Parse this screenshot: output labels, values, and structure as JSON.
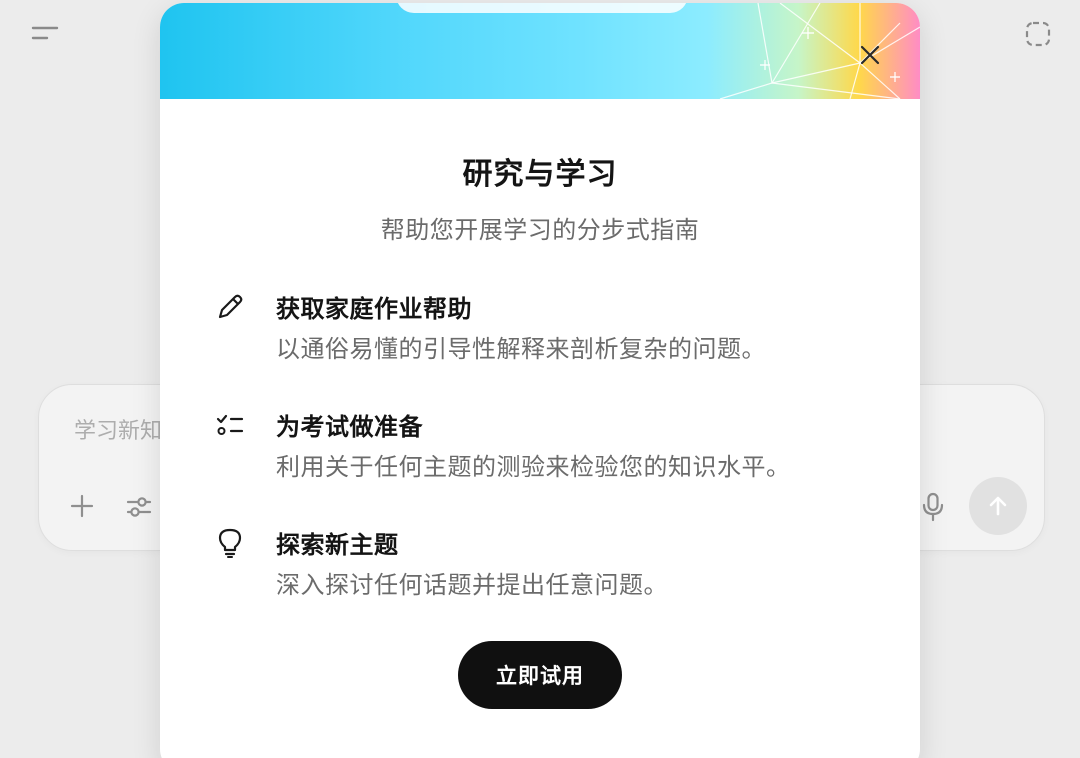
{
  "composer": {
    "placeholder": "学习新知识",
    "icons": [
      "plus-icon",
      "sliders-icon",
      "microphone-icon",
      "arrow-up-icon"
    ]
  },
  "header_icons": [
    "menu-icon",
    "dashed-square-icon"
  ],
  "dialog": {
    "title": "研究与学习",
    "subtitle": "帮助您开展学习的分步式指南",
    "close_icon": "close-icon",
    "features": [
      {
        "icon": "pencil-icon",
        "title": "获取家庭作业帮助",
        "description": "以通俗易懂的引导性解释来剖析复杂的问题。"
      },
      {
        "icon": "checklist-icon",
        "title": "为考试做准备",
        "description": "利用关于任何主题的测验来检验您的知识水平。"
      },
      {
        "icon": "lightbulb-icon",
        "title": "探索新主题",
        "description": "深入探讨任何话题并提出任意问题。"
      }
    ],
    "cta_label": "立即试用"
  },
  "colors": {
    "background": "#ececec",
    "dialog": "#ffffff",
    "cta": "#101010",
    "title": "#141414",
    "secondary_text": "#6b6b6b",
    "banner_cyan": "#4fd6fb"
  }
}
